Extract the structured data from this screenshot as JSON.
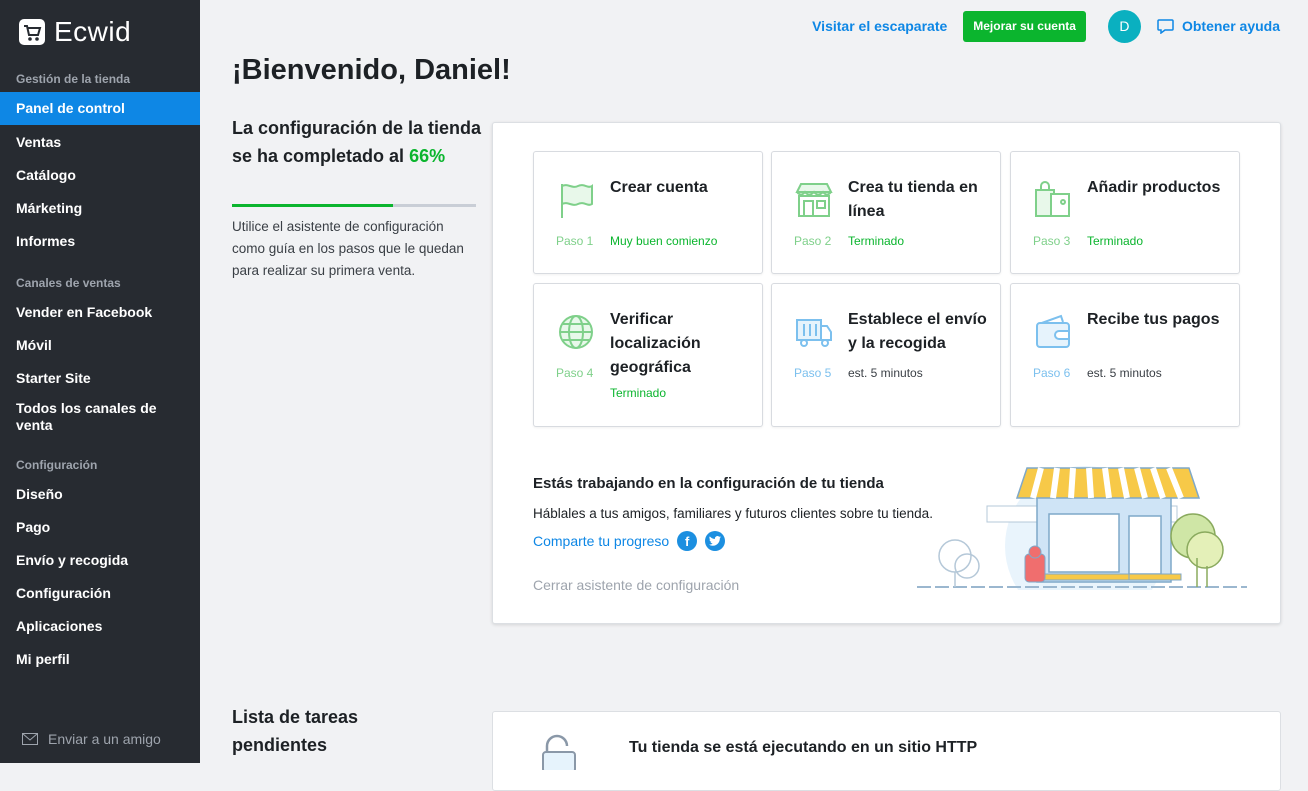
{
  "app": {
    "name": "Ecwid"
  },
  "sidebar": {
    "sections": [
      {
        "label": "Gestión de la tienda"
      },
      {
        "label": "Canales de ventas"
      },
      {
        "label": "Configuración"
      }
    ],
    "items": [
      {
        "label": "Panel de control",
        "active": true
      },
      {
        "label": "Ventas"
      },
      {
        "label": "Catálogo"
      },
      {
        "label": "Márketing"
      },
      {
        "label": "Informes"
      },
      {
        "label": "Vender en Facebook"
      },
      {
        "label": "Móvil"
      },
      {
        "label": "Starter Site"
      },
      {
        "label": "Todos los canales de venta"
      },
      {
        "label": "Diseño"
      },
      {
        "label": "Pago"
      },
      {
        "label": "Envío y recogida"
      },
      {
        "label": "Configuración"
      },
      {
        "label": "Aplicaciones"
      },
      {
        "label": "Mi perfil"
      }
    ],
    "invite_label": "Enviar a un amigo"
  },
  "topbar": {
    "visit_store": "Visitar el escaparate",
    "upgrade": "Mejorar su cuenta",
    "avatar_initial": "D",
    "help": "Obtener ayuda"
  },
  "welcome": "¡Bienvenido, Daniel!",
  "progress": {
    "title": "La configuración de la tienda se ha completado al",
    "percent_label": "66%",
    "percent_value": 66,
    "description": "Utilice el asistente de configuración como guía en los pasos que le quedan para realizar su primera venta."
  },
  "steps": [
    {
      "icon": "flag-icon",
      "step": "Paso 1",
      "title": "Crear cuenta",
      "status": "Muy buen comienzo",
      "done": true
    },
    {
      "icon": "storefront-icon",
      "step": "Paso 2",
      "title": "Crea tu tienda en línea",
      "status": "Terminado",
      "done": true
    },
    {
      "icon": "products-icon",
      "step": "Paso 3",
      "title": "Añadir productos",
      "status": "Terminado",
      "done": true
    },
    {
      "icon": "globe-icon",
      "step": "Paso 4",
      "title": "Verificar localización geográfica",
      "status": "Terminado",
      "done": true
    },
    {
      "icon": "truck-icon",
      "step": "Paso 5",
      "title": "Establece el envío y la recogida",
      "status": "est. 5 minutos",
      "done": false
    },
    {
      "icon": "wallet-icon",
      "step": "Paso 6",
      "title": "Recibe tus pagos",
      "status": "est. 5 minutos",
      "done": false
    }
  ],
  "working": {
    "title": "Estás trabajando en la configuración de tu tienda",
    "description": "Háblales a tus amigos, familiares y futuros clientes sobre tu tienda.",
    "share_link": "Comparte tu progreso",
    "close_wizard": "Cerrar asistente de configuración"
  },
  "tasks": {
    "title": "Lista de tareas pendientes",
    "first_task": "Tu tienda se está ejecutando en un sitio HTTP"
  },
  "colors": {
    "accent": "#0e87e5",
    "success": "#0bb52e",
    "sidebar": "#272b31"
  }
}
